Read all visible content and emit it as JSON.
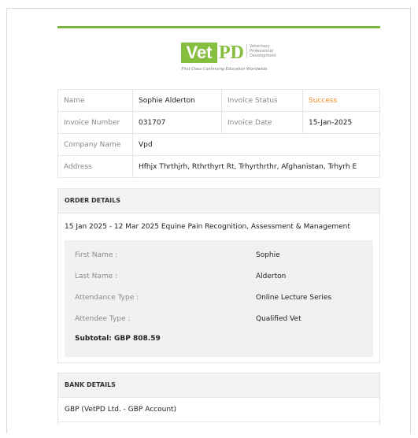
{
  "brand": {
    "logo_vet": "Vet",
    "logo_pd": "PD",
    "logo_sub": "Veterinary Professional Development",
    "tagline": "First Class Continuing Education Worldwide",
    "accent": "#7cb342"
  },
  "info": {
    "name_label": "Name",
    "name_value": "Sophie Alderton",
    "status_label": "Invoice Status",
    "status_value": "Success",
    "number_label": "Invoice Number",
    "number_value": "031707",
    "date_label": "Invoice Date",
    "date_value": "15-Jan-2025",
    "company_label": "Company Name",
    "company_value": "Vpd",
    "address_label": "Address",
    "address_value": "Hfhjx Thrthjrh, Rthrthyrt Rt, Trhyrthrthr, Afghanistan, Trhyrh E"
  },
  "order": {
    "heading": "ORDER DETAILS",
    "course": "15 Jan 2025 - 12 Mar 2025 Equine Pain Recognition, Assessment & Management",
    "rows": [
      {
        "label": "First Name :",
        "value": "Sophie"
      },
      {
        "label": "Last Name :",
        "value": "Alderton"
      },
      {
        "label": "Attendance Type :",
        "value": "Online Lecture Series"
      },
      {
        "label": "Attendee Type :",
        "value": "Qualified Vet"
      }
    ],
    "subtotal": "Subtotal: GBP 808.59"
  },
  "bank": {
    "heading": "BANK DETAILS",
    "account": "GBP (VetPD Ltd. - GBP Account)"
  }
}
